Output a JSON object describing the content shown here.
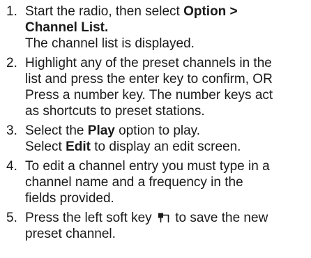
{
  "steps": [
    {
      "number": "1.",
      "line1_pre": "Start the radio, then select ",
      "line1_bold": "Option >",
      "line2_bold": "Channel List.",
      "line3": "The channel list is displayed."
    },
    {
      "number": "2.",
      "lines": [
        "Highlight any of the preset channels in the",
        "list and press the enter key to confirm, OR",
        "Press a number key. The number keys act",
        "as shortcuts to preset stations."
      ]
    },
    {
      "number": "3.",
      "line1_pre": "Select the ",
      "line1_bold": "Play",
      "line1_post": " option to play.",
      "line2_pre": "Select ",
      "line2_bold": "Edit",
      "line2_post": " to display an edit screen."
    },
    {
      "number": "4.",
      "lines": [
        "To edit a channel entry you must type in a",
        "channel name and a frequency in the",
        "fields provided."
      ]
    },
    {
      "number": "5.",
      "line1_pre": "Press the left soft key ",
      "line1_icon": "left-soft-key-icon",
      "line1_post": " to save the new",
      "line2": "preset channel."
    }
  ]
}
